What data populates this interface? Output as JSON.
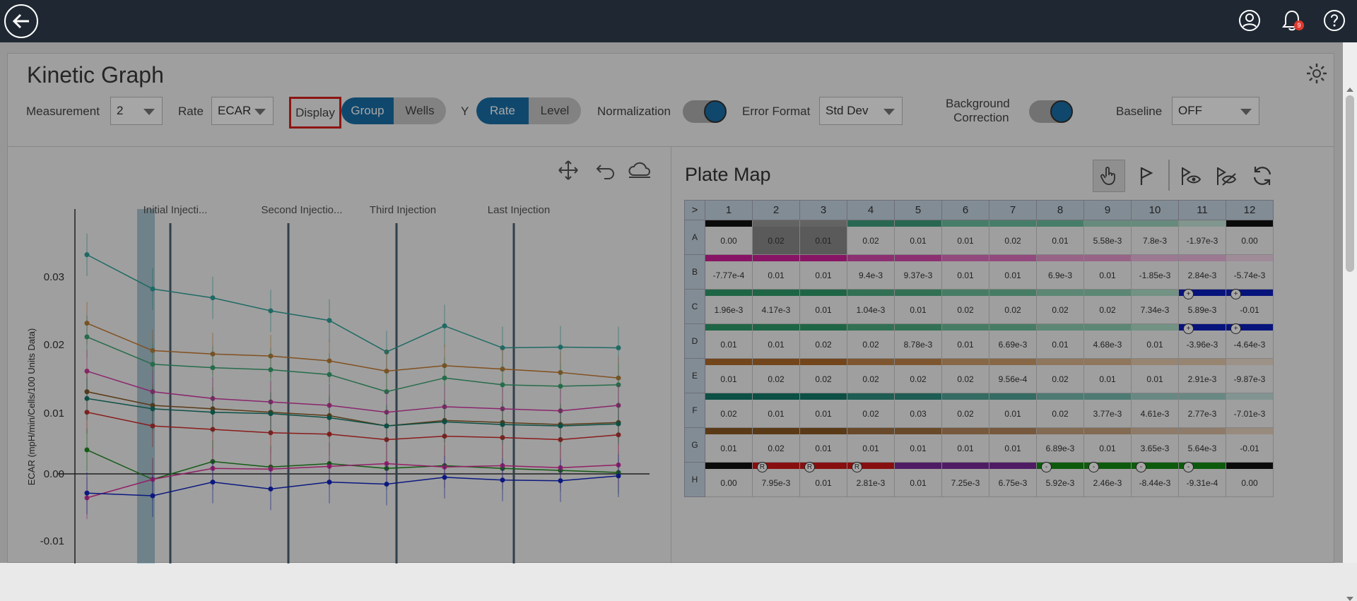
{
  "header": {
    "back": "back",
    "notification_count": "9"
  },
  "page": {
    "title": "Kinetic Graph"
  },
  "controls": {
    "measurement_label": "Measurement",
    "measurement_value": "2",
    "rate_label": "Rate",
    "rate_value": "ECAR",
    "display_label": "Display",
    "display_options": [
      "Group",
      "Wells"
    ],
    "display_selected": "Group",
    "y_label": "Y",
    "y_options": [
      "Rate",
      "Level"
    ],
    "y_selected": "Rate",
    "normalization_label": "Normalization",
    "normalization_on": true,
    "error_format_label": "Error Format",
    "error_format_value": "Std Dev",
    "background_label_1": "Background",
    "background_label_2": "Correction",
    "background_on": true,
    "baseline_label": "Baseline",
    "baseline_value": "OFF"
  },
  "graph": {
    "ylabel": "ECAR (mpH/min/Cells/100 Units Data)",
    "injections": [
      "Initial Injecti...",
      "Second Injectio...",
      "Third Injection",
      "Last Injection"
    ],
    "yticks": [
      "0.03",
      "0.02",
      "0.01",
      "0.00",
      "-0.01"
    ]
  },
  "plate": {
    "title": "Plate Map",
    "corner": ">",
    "cols": [
      "1",
      "2",
      "3",
      "4",
      "5",
      "6",
      "7",
      "8",
      "9",
      "10",
      "11",
      "12"
    ],
    "rows": [
      {
        "id": "A",
        "values": [
          "0.00",
          "0.02",
          "0.01",
          "0.02",
          "0.01",
          "0.01",
          "0.02",
          "0.01",
          "5.58e-3",
          "7.8e-3",
          "-1.97e-3",
          "0.00"
        ]
      },
      {
        "id": "B",
        "values": [
          "-7.77e-4",
          "0.01",
          "0.01",
          "9.4e-3",
          "9.37e-3",
          "0.01",
          "0.01",
          "6.9e-3",
          "0.01",
          "-1.85e-3",
          "2.84e-3",
          "-5.74e-3"
        ]
      },
      {
        "id": "C",
        "values": [
          "1.96e-3",
          "4.17e-3",
          "0.01",
          "1.04e-3",
          "0.01",
          "0.02",
          "0.02",
          "0.02",
          "0.02",
          "7.34e-3",
          "5.89e-3",
          "-0.01"
        ]
      },
      {
        "id": "D",
        "values": [
          "0.01",
          "0.01",
          "0.02",
          "0.02",
          "8.78e-3",
          "0.01",
          "6.69e-3",
          "0.01",
          "4.68e-3",
          "0.01",
          "-3.96e-3",
          "-4.64e-3"
        ]
      },
      {
        "id": "E",
        "values": [
          "0.01",
          "0.02",
          "0.02",
          "0.02",
          "0.02",
          "0.02",
          "9.56e-4",
          "0.02",
          "0.01",
          "0.01",
          "2.91e-3",
          "-9.87e-3"
        ]
      },
      {
        "id": "F",
        "values": [
          "0.02",
          "0.01",
          "0.01",
          "0.02",
          "0.03",
          "0.02",
          "0.01",
          "0.02",
          "3.77e-3",
          "4.61e-3",
          "2.77e-3",
          "-7.01e-3"
        ]
      },
      {
        "id": "G",
        "values": [
          "0.01",
          "0.02",
          "0.01",
          "0.01",
          "0.01",
          "0.01",
          "0.01",
          "6.89e-3",
          "0.01",
          "3.65e-3",
          "5.64e-3",
          "-0.01"
        ]
      },
      {
        "id": "H",
        "values": [
          "0.00",
          "7.95e-3",
          "0.01",
          "2.81e-3",
          "0.01",
          "7.25e-3",
          "6.75e-3",
          "5.92e-3",
          "2.46e-3",
          "-8.44e-3",
          "-9.31e-4",
          "0.00"
        ]
      }
    ]
  }
}
